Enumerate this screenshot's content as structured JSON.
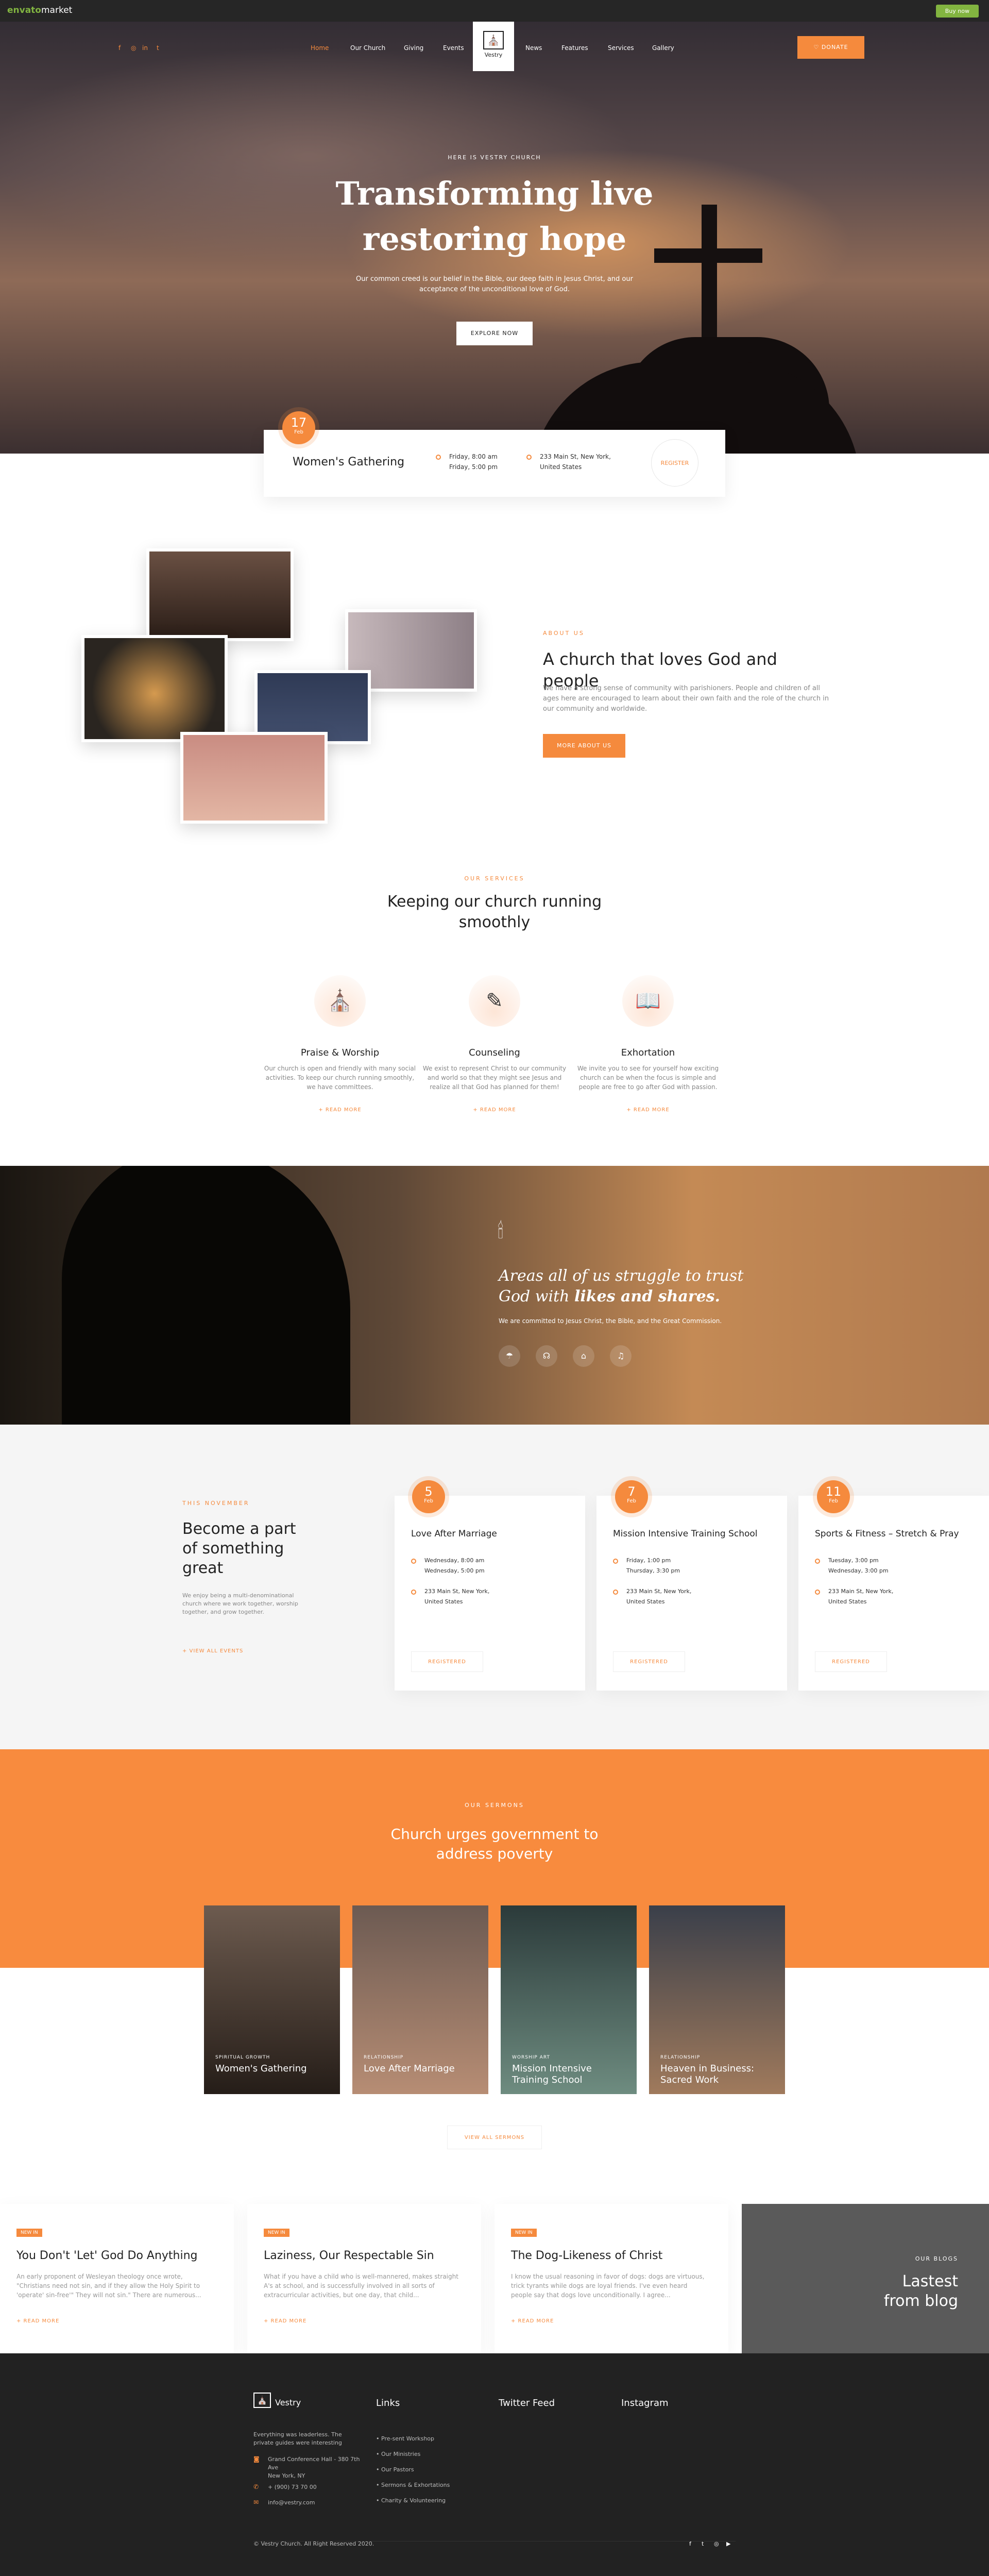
{
  "envato": {
    "logo_prefix": "envato",
    "logo_suffix": "market",
    "buy_label": "Buy now"
  },
  "nav": {
    "social": [
      "f",
      "◎",
      "in",
      "t"
    ],
    "left": [
      "Home",
      "Our Church",
      "Giving",
      "Events"
    ],
    "brand": "Vestry",
    "right": [
      "News",
      "Features",
      "Services",
      "Gallery"
    ],
    "donate": "DONATE"
  },
  "hero": {
    "subtitle": "HERE IS VESTRY CHURCH",
    "title_line1": "Transforming live",
    "title_line2": "restoring hope",
    "desc": "Our common creed is our belief in the Bible, our deep faith in Jesus Christ, and our acceptance of the unconditional love of God.",
    "button": "EXPLORE NOW"
  },
  "featured_event": {
    "day": "17",
    "month": "Feb",
    "title": "Women's Gathering",
    "time1": "Friday, 8:00 am",
    "time2": "Friday, 5:00 pm",
    "addr1": "233 Main St, New York,",
    "addr2": "United States",
    "register": "REGISTER"
  },
  "about": {
    "label": "ABOUT US",
    "title": "A church that loves God and people",
    "text": "We have a strong sense of community with parishioners. People and children of all ages here are encouraged to learn about their own faith and the role of the church in our community and worldwide.",
    "button": "MORE ABOUT US"
  },
  "services": {
    "label": "OUR SERVICES",
    "title_line1": "Keeping our church running",
    "title_line2": "smoothly",
    "items": [
      {
        "icon": "⛪",
        "title": "Praise & Worship",
        "text": "Our church is open and friendly with many social activities. To keep our church running smoothly, we have committees.",
        "more": "+ READ MORE"
      },
      {
        "icon": "✎",
        "title": "Counseling",
        "text": "We exist to represent Christ to our community and world so that they might see Jesus and realize all that God has planned for them!",
        "more": "+ READ MORE"
      },
      {
        "icon": "📖",
        "title": "Exhortation",
        "text": "We invite you to see for yourself how exciting church can be when the focus is simple and people are free to go after God with passion.",
        "more": "+ READ MORE"
      }
    ]
  },
  "quote": {
    "title_line1": "Areas all of us struggle to trust",
    "title_line2_plain": "God with ",
    "title_line2_em": "likes and shares.",
    "desc": "We are committed to Jesus Christ, the Bible, and the Great Commission.",
    "icons": [
      "☂",
      "☊",
      "⌂",
      "♫"
    ]
  },
  "events": {
    "label": "THIS NOVEMBER",
    "title_line1": "Become a part",
    "title_line2": "of something",
    "title_line3": "great",
    "text": "We enjoy being a multi-denominational church where we work together, worship together, and grow together.",
    "view_all": "+ VIEW ALL EVENTS",
    "items": [
      {
        "day": "5",
        "month": "Feb",
        "title": "Love After Marriage",
        "time1": "Wednesday, 8:00 am",
        "time2": "Wednesday, 5:00 pm",
        "addr1": "233 Main St, New York,",
        "addr2": "United States",
        "register": "REGISTERED"
      },
      {
        "day": "7",
        "month": "Feb",
        "title": "Mission Intensive Training School",
        "time1": "Friday, 1:00 pm",
        "time2": "Thursday, 3:30 pm",
        "addr1": "233 Main St, New York,",
        "addr2": "United States",
        "register": "REGISTERED"
      },
      {
        "day": "11",
        "month": "Feb",
        "title": "Sports & Fitness – Stretch & Pray",
        "time1": "Tuesday, 3:00 pm",
        "time2": "Wednesday, 3:00 pm",
        "addr1": "233 Main St, New York,",
        "addr2": "United States",
        "register": "REGISTERED"
      }
    ]
  },
  "sermons": {
    "label": "OUR SERMONS",
    "title_line1": "Church urges government to",
    "title_line2": "address poverty",
    "items": [
      {
        "category": "SPIRITUAL GROWTH",
        "name": "Women's Gathering"
      },
      {
        "category": "RELATIONSHIP",
        "name": "Love After Marriage"
      },
      {
        "category": "WORSHIP ART",
        "name": "Mission Intensive Training School"
      },
      {
        "category": "RELATIONSHIP",
        "name": "Heaven in Business: Sacred Work"
      }
    ],
    "view_all": "VIEW ALL SERMONS"
  },
  "blog": {
    "side_label": "OUR BLOGS",
    "side_title_line1": "Lastest",
    "side_title_line2": "from blog",
    "items": [
      {
        "tag": "NEW IN",
        "title": "You Don't 'Let' God Do Anything",
        "text": "An early proponent of Wesleyan theology once wrote, \"Christians need not sin, and if they allow the Holy Spirit to 'operate' sin-free'\" They will not sin.\" There are numerous...",
        "more": "+ READ MORE"
      },
      {
        "tag": "NEW IN",
        "title": "Laziness, Our Respectable Sin",
        "text": "What if you have a child who is well-mannered, makes straight A's at school, and is successfully involved in all sorts of extracurricular activities, but one day, that child...",
        "more": "+ READ MORE"
      },
      {
        "tag": "NEW IN",
        "title": "The Dog-Likeness of Christ",
        "text": "I know the usual reasoning in favor of dogs: dogs are virtuous, trick tyrants while dogs are loyal friends. I've even heard people say that dogs love unconditionally. I agree...",
        "more": "+ READ MORE"
      }
    ]
  },
  "footer": {
    "brand": "Vestry",
    "about": "Everything was leaderless. The private guides were interesting",
    "address_line1": "Grand Conference Hall - 380 7th Ave",
    "address_line2": "New York, NY",
    "phone": "+ (900) 73 70 00",
    "email": "info@vestry.com",
    "links_title": "Links",
    "links": [
      "Pre-sent Workshop",
      "Our Ministries",
      "Our Pastors",
      "Sermons & Exhortations",
      "Charity & Volunteering"
    ],
    "twitter_title": "Twitter Feed",
    "instagram_title": "Instagram",
    "copyright": "© Vestry Church. All Right Reserved 2020.",
    "social": [
      "f",
      "t",
      "◎",
      "▶"
    ]
  },
  "colors": {
    "accent": "#f58a3d",
    "dark": "#222222",
    "envato_green": "#82b440"
  }
}
